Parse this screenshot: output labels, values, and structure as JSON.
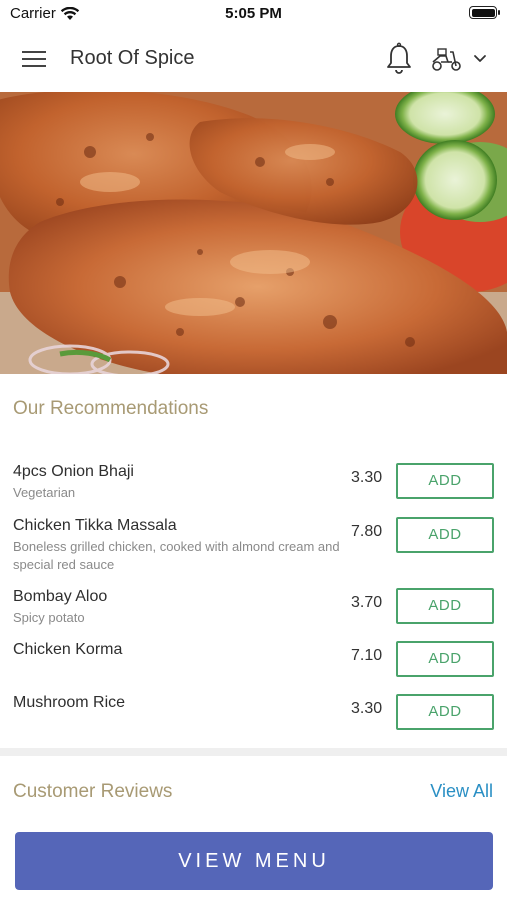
{
  "status_bar": {
    "carrier": "Carrier",
    "time": "5:05 PM",
    "wifi_icon": "wifi-icon",
    "battery_icon": "battery-icon"
  },
  "header": {
    "title": "Root Of Spice",
    "menu_icon": "hamburger-menu-icon",
    "bell_icon": "bell-icon",
    "delivery_icon": "scooter-icon",
    "dropdown_icon": "chevron-down-icon"
  },
  "hero": {
    "image": "tandoori-chicken-photo"
  },
  "recommendations": {
    "title": "Our Recommendations",
    "add_label": "ADD",
    "items": [
      {
        "name": "4pcs Onion Bhaji",
        "description": "Vegetarian",
        "price": "3.30"
      },
      {
        "name": "Chicken Tikka Massala",
        "description": "Boneless grilled chicken, cooked with almond cream and special red sauce",
        "price": "7.80"
      },
      {
        "name": "Bombay Aloo",
        "description": "Spicy potato",
        "price": "3.70"
      },
      {
        "name": "Chicken Korma",
        "description": "",
        "price": "7.10"
      },
      {
        "name": "Mushroom Rice",
        "description": "",
        "price": "3.30"
      }
    ]
  },
  "reviews": {
    "title": "Customer Reviews",
    "view_all_label": "View All"
  },
  "footer": {
    "view_menu_label": "VIEW MENU"
  },
  "colors": {
    "accent_gold": "#a89a74",
    "add_green": "#4aa36b",
    "link_blue": "#2a8fc4",
    "cta_blue": "#5566b8"
  }
}
